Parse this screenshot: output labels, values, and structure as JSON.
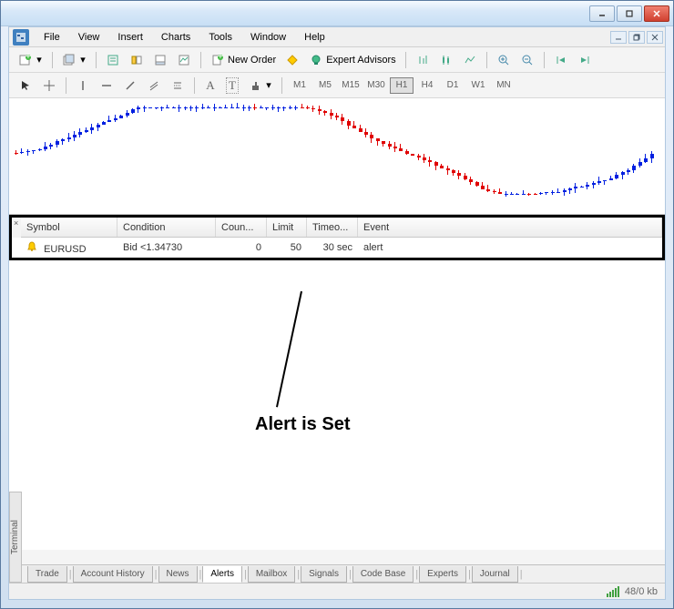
{
  "menu": {
    "items": [
      "File",
      "View",
      "Insert",
      "Charts",
      "Tools",
      "Window",
      "Help"
    ]
  },
  "toolbar1": {
    "new_order": "New Order",
    "expert_advisors": "Expert Advisors"
  },
  "timeframes": [
    "M1",
    "M5",
    "M15",
    "M30",
    "H1",
    "H4",
    "D1",
    "W1",
    "MN"
  ],
  "active_timeframe": "H1",
  "alerts": {
    "columns": {
      "symbol": "Symbol",
      "condition": "Condition",
      "counter": "Coun...",
      "limit": "Limit",
      "timeout": "Timeo...",
      "event": "Event"
    },
    "rows": [
      {
        "symbol": "EURUSD",
        "condition": "Bid <1.34730",
        "counter": "0",
        "limit": "50",
        "timeout": "30 sec",
        "event": "alert"
      }
    ]
  },
  "annotation": "Alert is Set",
  "terminal_label": "Terminal",
  "tabs": [
    "Trade",
    "Account History",
    "News",
    "Alerts",
    "Mailbox",
    "Signals",
    "Code Base",
    "Experts",
    "Journal"
  ],
  "active_tab": "Alerts",
  "status": {
    "traffic": "48/0 kb"
  },
  "tool_label_text": "A",
  "tool_label_text2": "T"
}
